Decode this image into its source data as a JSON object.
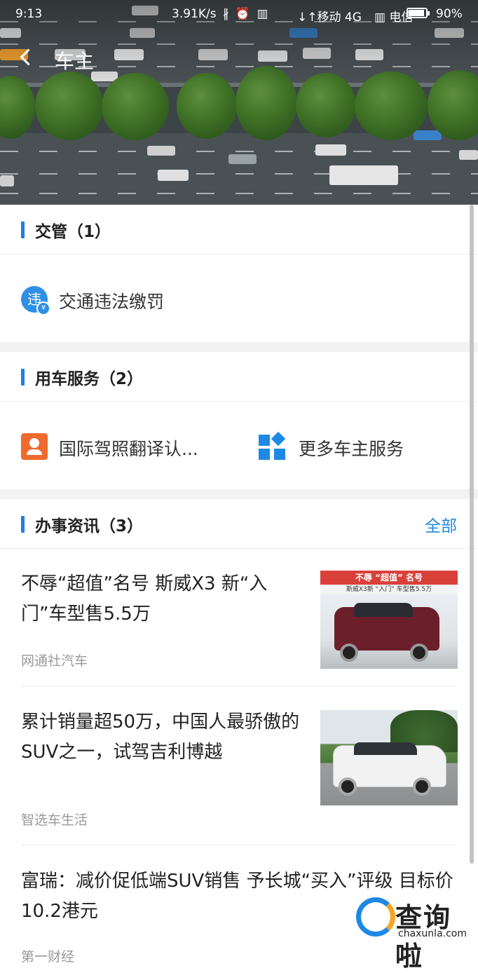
{
  "status_bar": {
    "time": "9:13",
    "net_speed": "3.91K/s",
    "icons": "∦ ⏰ ▥",
    "carrier1": "↓↑移动 4G",
    "carrier2": "▥ 电信",
    "battery": "90%",
    "battery_level": 0.9
  },
  "nav": {
    "title": "车主"
  },
  "sections": {
    "traffic": {
      "title": "交管（1）",
      "items": [
        {
          "label": "交通违法缴罚",
          "icon": "violation-icon",
          "icon_char": "违"
        }
      ]
    },
    "car_service": {
      "title": "用车服务（2）",
      "items": [
        {
          "label": "国际驾照翻译认...",
          "icon": "driver-license-icon"
        },
        {
          "label": "更多车主服务",
          "icon": "more-services-icon"
        }
      ]
    },
    "news": {
      "title": "办事资讯（3）",
      "more_label": "全部",
      "items": [
        {
          "title": "不辱“超值”名号 斯威X3 新“入门”车型售5.5万",
          "source": "网通社汽车",
          "thumb_caption": "不辱 “超值” 名号",
          "thumb_sub": "斯威X3新 “入门” 车型售5.5万"
        },
        {
          "title": "累计销量超50万，中国人最骄傲的SUV之一，试驾吉利博越",
          "source": "智选车生活"
        },
        {
          "title": "富瑞：减价促低端SUV销售 予长城“买入”评级 目标价10.2港元",
          "source": "第一财经"
        }
      ]
    }
  },
  "watermark": {
    "text": "查询啦",
    "sub": "chaxunla.com"
  },
  "colors": {
    "accent": "#1e88e5",
    "section_bar": "#1e7fe0",
    "license_icon": "#ef6a2e"
  }
}
